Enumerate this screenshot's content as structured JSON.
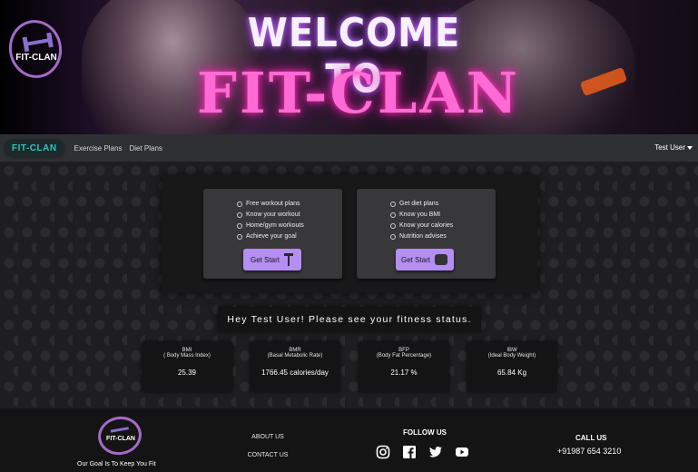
{
  "hero": {
    "line1": "WELCOME TO",
    "line2": "FIT-CLAN",
    "logo_text": "FIT-CLAN"
  },
  "navbar": {
    "brand": "FIT-CLAN",
    "links": [
      "Exercise Plans",
      "Diet Plans"
    ],
    "user": "Test User"
  },
  "plans": {
    "exercise": {
      "items": [
        "Free workout plans",
        "Know your workout",
        "Home/gym workouts",
        "Achieve your goal"
      ],
      "button": "Get Start",
      "icon": "dumbbell-icon"
    },
    "diet": {
      "items": [
        "Get diet plans",
        "Know you BMI",
        "Know your calories",
        "Nutrition advises"
      ],
      "button": "Get Start",
      "icon": "scale-icon"
    }
  },
  "greeting": "Hey Test User! Please see your fitness status.",
  "metrics": [
    {
      "name": "BMI",
      "desc": "( Body Mass Index)",
      "value": "25.39"
    },
    {
      "name": "BMR",
      "desc": "(Basal Metabolic Rate)",
      "value": "1766.45 calories/day"
    },
    {
      "name": "BFP",
      "desc": "(Body Fat Percentage)",
      "value": "21.17 %"
    },
    {
      "name": "IBW",
      "desc": "(Ideal Body Weight)",
      "value": "65.84 Kg"
    }
  ],
  "footer": {
    "logo_text": "FIT-CLAN",
    "tagline": "Our Goal Is To Keep You Fit",
    "links": [
      "ABOUT US",
      "CONTACT US"
    ],
    "follow_heading": "FOLLOW US",
    "social": [
      "instagram-icon",
      "facebook-icon",
      "twitter-icon",
      "youtube-icon"
    ],
    "call_heading": "CALL US",
    "phone": "+91987 654 3210"
  },
  "colors": {
    "accent": "#b48ef0",
    "brand_teal": "#2fc5c0",
    "hero_pink": "#ff6ad5",
    "logo_purple": "#a46acb"
  }
}
